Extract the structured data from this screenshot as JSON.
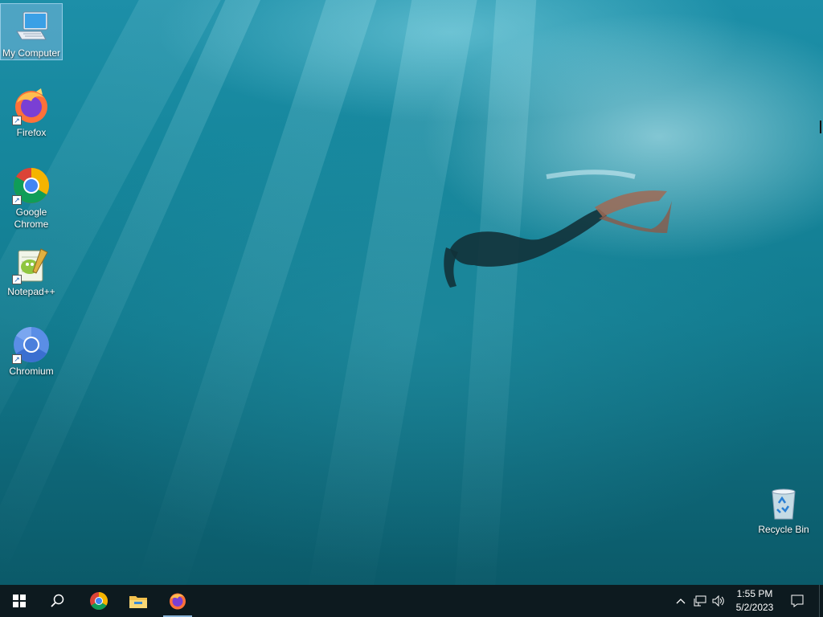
{
  "desktop": {
    "wallpaper": "underwater-freediver",
    "icons": [
      {
        "label": "My Computer",
        "icon": "computer-icon",
        "selected": true
      },
      {
        "label": "Firefox",
        "icon": "firefox-icon",
        "shortcut": true
      },
      {
        "label": "Google Chrome",
        "icon": "chrome-icon",
        "shortcut": true
      },
      {
        "label": "Notepad++",
        "icon": "notepad-plus-plus-icon",
        "shortcut": true
      },
      {
        "label": "Chromium",
        "icon": "chromium-icon",
        "shortcut": true
      },
      {
        "label": "Recycle Bin",
        "icon": "recycle-bin-icon"
      }
    ]
  },
  "taskbar": {
    "pinned": [
      {
        "name": "start-icon"
      },
      {
        "name": "search-icon"
      },
      {
        "name": "chrome-icon"
      },
      {
        "name": "file-explorer-icon"
      },
      {
        "name": "firefox-icon",
        "active": true
      }
    ],
    "tray": {
      "icons": [
        "chevron-up-icon",
        "network-icon",
        "volume-icon"
      ],
      "time": "1:55 PM",
      "date": "5/2/2023",
      "notification_icon": "action-center-icon"
    },
    "colors": {
      "background": "#0d1a1f",
      "active_indicator": "#8ab4d8"
    }
  }
}
